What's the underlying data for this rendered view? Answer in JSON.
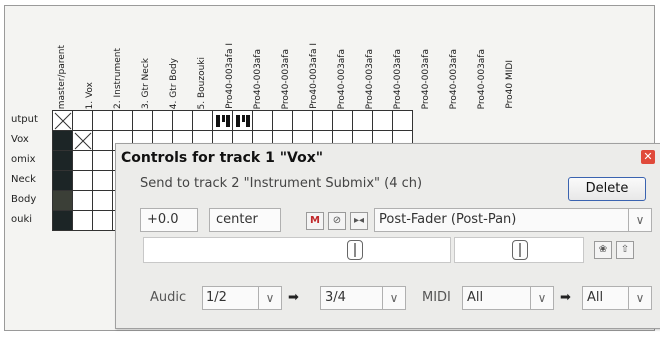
{
  "columns": [
    "master/parent",
    "1. Vox",
    "2. Instrument",
    "3. Gtr Neck",
    "4. Gtr Body",
    "5. Bouzouki",
    "Pro40-003afa I",
    "Pro40-003afa",
    "Pro40-003afa",
    "Pro40-003afa I",
    "Pro40-003afa",
    "Pro40-003afa",
    "Pro40-003afa",
    "Pro40-003afa",
    "Pro40-003afa",
    "Pro40-003afa",
    "Pro40 MIDI"
  ],
  "rows": [
    "utput",
    "Vox",
    "omix",
    "Neck",
    "Body",
    "ouki"
  ],
  "dialog": {
    "title": "Controls for track 1 \"Vox\"",
    "send_text": "Send to track 2 \"Instrument Submix\" (4 ch)",
    "delete_label": "Delete",
    "volume": "+0.0",
    "pan": "center",
    "mute_label": "M",
    "mode": "Post-Fader (Post-Pan)",
    "audio_label": "Audic",
    "audio_src": "1/2",
    "audio_dst": "3/4",
    "midi_label": "MIDI",
    "midi_src": "All",
    "midi_dst": "All",
    "arrow": "➡"
  },
  "colors": {
    "dark_cell": "#1c2526",
    "accent_close": "#e04a3b"
  }
}
